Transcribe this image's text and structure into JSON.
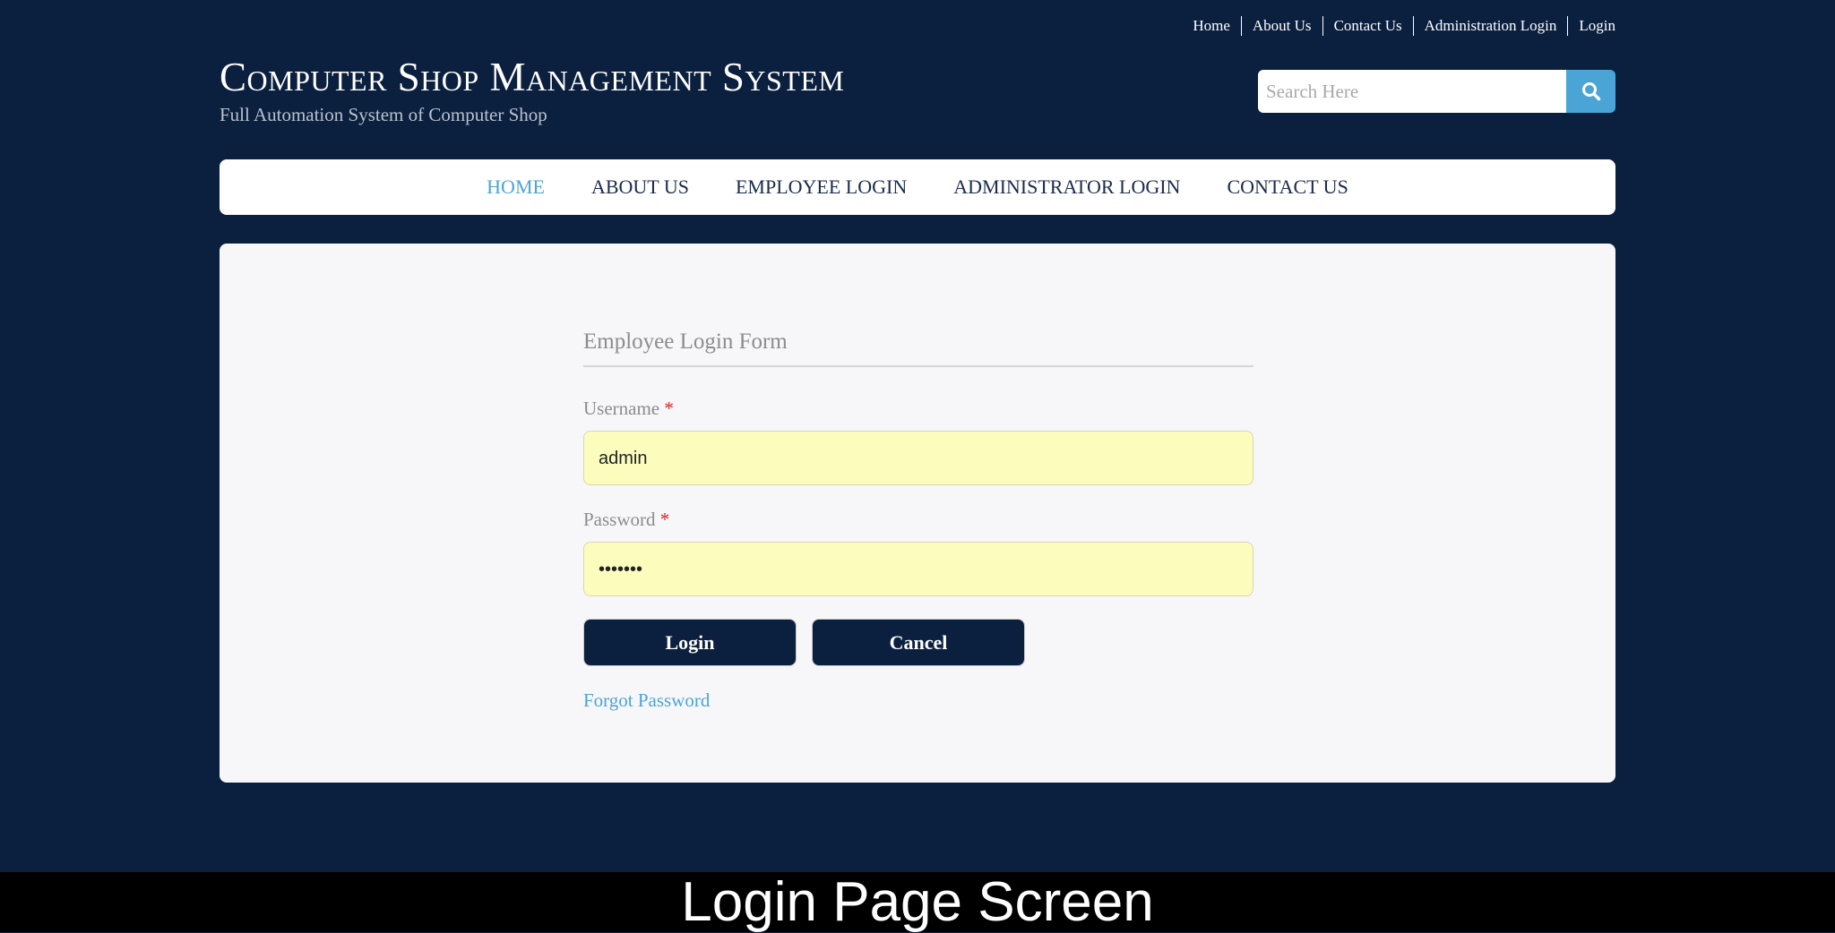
{
  "top_links": [
    "Home",
    "About Us",
    "Contact Us",
    "Administration Login",
    "Login"
  ],
  "brand": {
    "title": "Computer Shop Management System",
    "subtitle": "Full Automation System of Computer Shop"
  },
  "search": {
    "placeholder": "Search Here",
    "icon": "search-icon"
  },
  "nav": {
    "items": [
      "HOME",
      "ABOUT US",
      "EMPLOYEE LOGIN",
      "ADMINISTRATOR LOGIN",
      "CONTACT US"
    ],
    "active": "HOME"
  },
  "form": {
    "title": "Employee Login Form",
    "username_label": "Username",
    "username_value": "admin",
    "password_label": "Password",
    "password_value": "•••••••",
    "required_mark": "*",
    "login_label": "Login",
    "cancel_label": "Cancel",
    "forgot_label": "Forgot Password"
  },
  "caption": "Login Page Screen",
  "colors": {
    "background": "#0b1f3f",
    "accent": "#4aa5d6",
    "input_bg": "#fcfdbd",
    "required": "#e02020"
  }
}
